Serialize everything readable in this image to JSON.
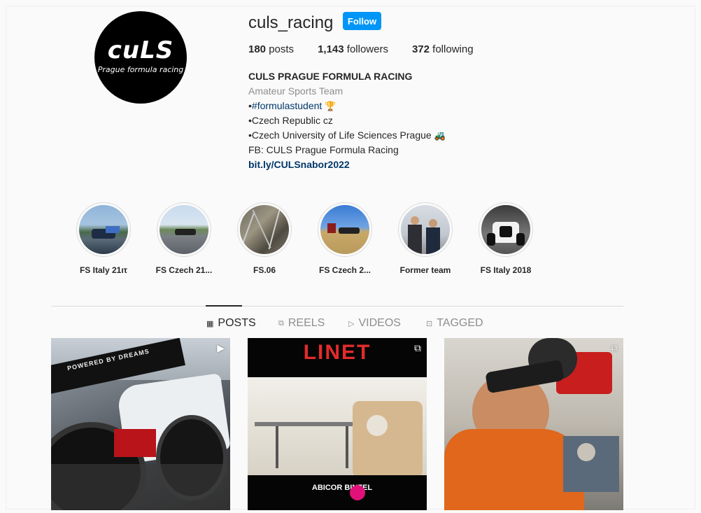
{
  "profile": {
    "username": "culs_racing",
    "follow_label": "Follow",
    "avatar_logo": "cuLS",
    "avatar_tagline": "Prague formula racing",
    "stats": [
      {
        "count": "180",
        "label": "posts"
      },
      {
        "count": "1,143",
        "label": "followers"
      },
      {
        "count": "372",
        "label": "following"
      }
    ],
    "bio": {
      "name": "CULS PRAGUE FORMULA RACING",
      "category": "Amateur Sports Team",
      "line1_prefix": "•",
      "line1_hashtag": "#formulastudent",
      "line1_emoji": "🏆",
      "line2": "•Czech Republic cz",
      "line3": "•Czech University of Life Sciences Prague",
      "line3_emoji": "🚜",
      "line4": "FB: CULS Prague Formula Racing",
      "link": "bit.ly/CULSnabor2022"
    }
  },
  "highlights": [
    {
      "label": "FS Italy 21ιτ"
    },
    {
      "label": "FS Czech 21..."
    },
    {
      "label": "FS.06"
    },
    {
      "label": "FS Czech 2..."
    },
    {
      "label": "Former team"
    },
    {
      "label": "FS Italy 2018"
    }
  ],
  "tabs": [
    {
      "label": "POSTS",
      "icon": "grid-icon",
      "active": true
    },
    {
      "label": "REELS",
      "icon": "reels-icon",
      "active": false
    },
    {
      "label": "VIDEOS",
      "icon": "video-icon",
      "active": false
    },
    {
      "label": "TAGGED",
      "icon": "tagged-icon",
      "active": false
    }
  ],
  "posts": [
    {
      "type": "video",
      "type_icon": "play-icon",
      "overlay_text": "POWERED BY DREAMS"
    },
    {
      "type": "reel",
      "type_icon": "reels-icon",
      "overlay_text": "LINET",
      "sponsor": "ABICOR BINZEL"
    },
    {
      "type": "reel",
      "type_icon": "reels-icon"
    }
  ]
}
